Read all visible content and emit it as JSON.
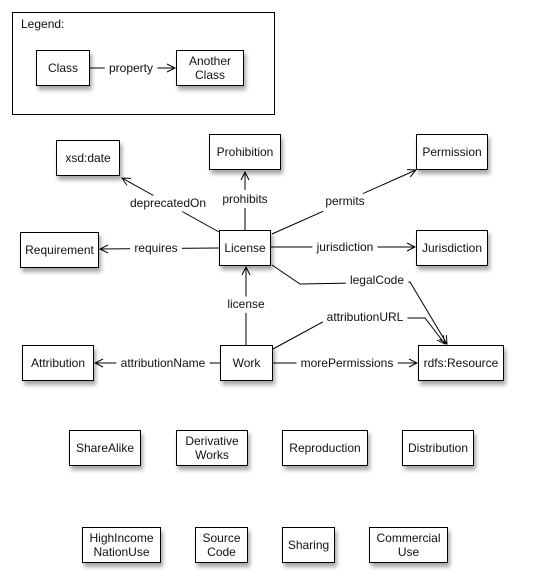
{
  "legend": {
    "title": "Legend:",
    "class": "Class",
    "property": "property",
    "another_class": "Another Class"
  },
  "nodes": {
    "xsd_date": "xsd:date",
    "prohibition": "Prohibition",
    "permission": "Permission",
    "requirement": "Requirement",
    "license": "License",
    "jurisdiction": "Jurisdiction",
    "attribution": "Attribution",
    "work": "Work",
    "rdfs_resource": "rdfs:Resource",
    "sharealike": "ShareAlike",
    "derivative_works": "Derivative Works",
    "reproduction": "Reproduction",
    "distribution": "Distribution",
    "high_income_nation_use": "HighIncome NationUse",
    "source_code": "Source Code",
    "sharing": "Sharing",
    "commercial_use": "Commercial Use"
  },
  "edges": {
    "deprecatedOn": "deprecatedOn",
    "prohibits": "prohibits",
    "permits": "permits",
    "requires": "requires",
    "jurisdiction": "jurisdiction",
    "legalCode": "legalCode",
    "license": "license",
    "attributionURL": "attributionURL",
    "attributionName": "attributionName",
    "morePermissions": "morePermissions"
  }
}
